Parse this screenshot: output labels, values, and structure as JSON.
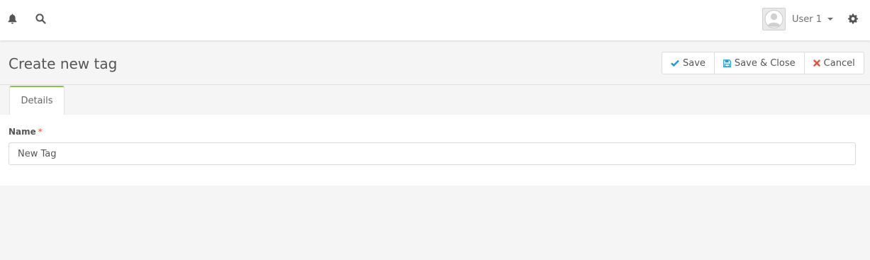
{
  "topbar": {
    "icons": {
      "notifications": "bell-icon",
      "search": "search-icon",
      "settings": "gear-icon",
      "avatar": "user-avatar-icon"
    },
    "user_name": "User 1"
  },
  "header": {
    "title": "Create new tag",
    "buttons": {
      "save": "Save",
      "save_close": "Save & Close",
      "cancel": "Cancel"
    }
  },
  "tabs": {
    "details": "Details"
  },
  "form": {
    "name_label": "Name",
    "required_marker": "*",
    "name_value": "New Tag"
  },
  "colors": {
    "accent_tab": "#8bc34a",
    "save_check": "#1a9bd7",
    "save_close_icon": "#1a9bd7",
    "cancel_x": "#e74c3c",
    "required": "#e74c3c"
  }
}
